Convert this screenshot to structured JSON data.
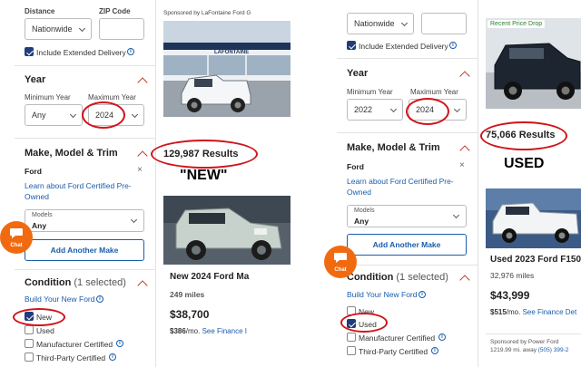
{
  "left": {
    "distance": {
      "label": "Distance",
      "value": "Nationwide"
    },
    "zip": {
      "label": "ZIP Code",
      "value": ""
    },
    "extended_delivery": {
      "label": "Include Extended Delivery",
      "checked": true
    },
    "year": {
      "title": "Year",
      "min_label": "Minimum Year",
      "max_label": "Maximum Year",
      "min_value": "Any",
      "max_value": "2024"
    },
    "make_model": {
      "title": "Make, Model & Trim",
      "make": "Ford",
      "link": "Learn about Ford Certified Pre-Owned",
      "models_label": "Models",
      "models_value": "Any",
      "add_button": "Add Another Make"
    },
    "condition": {
      "title": "Condition",
      "count": "(1 selected)",
      "build_link": "Build Your New Ford",
      "options": [
        {
          "label": "New",
          "checked": true
        },
        {
          "label": "Used",
          "checked": false
        },
        {
          "label": "Manufacturer Certified",
          "checked": false
        },
        {
          "label": "Third-Party Certified",
          "checked": false
        }
      ]
    },
    "chat_label": "Chat",
    "sponsor": "Sponsored by LaFontaine Ford G",
    "dealer_sign": "LAFONTAINE",
    "results": "129,987 Results",
    "annotation": "\"NEW\"",
    "card": {
      "title": "New 2024 Ford Ma",
      "miles": "249 miles",
      "price": "$38,700",
      "monthly_amount": "$386",
      "monthly_suffix": "/mo.",
      "finance_link": "See Finance I"
    }
  },
  "right": {
    "distance": {
      "value": "Nationwide"
    },
    "extended_delivery": {
      "label": "Include Extended Delivery",
      "checked": true
    },
    "year": {
      "title": "Year",
      "min_label": "Minimum Year",
      "max_label": "Maximum Year",
      "min_value": "2022",
      "max_value": "2024"
    },
    "make_model": {
      "title": "Make, Model & Trim",
      "make": "Ford",
      "link": "Learn about Ford Certified Pre-Owned",
      "models_label": "Models",
      "models_value": "Any",
      "add_button": "Add Another Make"
    },
    "condition": {
      "title": "Condition",
      "count": "(1 selected)",
      "build_link": "Build Your New Ford",
      "options": [
        {
          "label": "New",
          "checked": false
        },
        {
          "label": "Used",
          "checked": true
        },
        {
          "label": "Manufacturer Certified",
          "checked": false
        },
        {
          "label": "Third-Party Certified",
          "checked": false
        }
      ]
    },
    "chat_label": "Chat",
    "badge": "Recent Price Drop",
    "results": "75,066 Results",
    "annotation": "USED",
    "card": {
      "title": "Used 2023 Ford F150",
      "miles": "32,976 miles",
      "price": "$43,999",
      "monthly_amount": "$515",
      "monthly_suffix": "/mo.",
      "finance_link": "See Finance Det",
      "sponsor": "Sponsored by Power Ford",
      "distance": "1219.99 mi. away",
      "phone": "(505) 399-2"
    }
  },
  "colors": {
    "accent_red": "#d0141b",
    "link_blue": "#1a5dab",
    "chat_orange": "#f26a0f",
    "checkbox_navy": "#1f3d7a"
  }
}
